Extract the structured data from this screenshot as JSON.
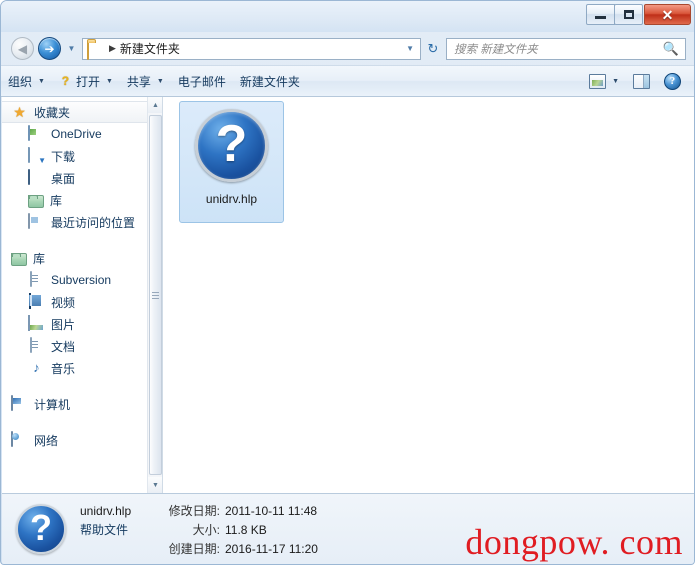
{
  "window": {
    "controls": {
      "minimize": "—",
      "maximize": "□",
      "close": "✕"
    }
  },
  "addressbar": {
    "back_icon": "◀",
    "forward_icon": "➔",
    "history_caret": "▼",
    "folder_icon": "folder-icon",
    "path_separator": "▶",
    "path": "新建文件夹",
    "path_caret": "▼",
    "refresh_icon": "↻"
  },
  "search": {
    "placeholder": "搜索 新建文件夹",
    "icon": "search-icon"
  },
  "toolbar": {
    "items": [
      {
        "label": "组织",
        "caret": "▼",
        "has_icon": false
      },
      {
        "label": "打开",
        "caret": "▼",
        "has_icon": true
      },
      {
        "label": "共享",
        "caret": "▼",
        "has_icon": false
      },
      {
        "label": "电子邮件",
        "caret": "",
        "has_icon": false
      },
      {
        "label": "新建文件夹",
        "caret": "",
        "has_icon": false
      }
    ],
    "view_caret": "▼",
    "view_icon": "view-options-icon",
    "pane_icon": "preview-pane-icon",
    "help_icon": "?"
  },
  "sidebar": {
    "favorites": {
      "label": "收藏夹",
      "icon": "star-icon",
      "items": [
        {
          "label": "OneDrive",
          "icon": "onedrive-icon"
        },
        {
          "label": "下载",
          "icon": "download-icon"
        },
        {
          "label": "桌面",
          "icon": "desktop-icon"
        },
        {
          "label": "库",
          "icon": "library-folder-icon"
        },
        {
          "label": "最近访问的位置",
          "icon": "recent-places-icon"
        }
      ]
    },
    "libraries": {
      "label": "库",
      "icon": "library-folder-icon",
      "items": [
        {
          "label": "Subversion",
          "icon": "document-icon"
        },
        {
          "label": "视频",
          "icon": "video-icon"
        },
        {
          "label": "图片",
          "icon": "picture-icon"
        },
        {
          "label": "文档",
          "icon": "document-icon"
        },
        {
          "label": "音乐",
          "icon": "music-icon"
        }
      ]
    },
    "computer": {
      "label": "计算机",
      "icon": "computer-icon"
    },
    "network": {
      "label": "网络",
      "icon": "network-icon"
    },
    "scrollbar": {
      "up": "▲",
      "down": "▼"
    }
  },
  "content": {
    "file": {
      "name": "unidrv.hlp",
      "icon": "help-file-icon",
      "icon_glyph": "?",
      "selected": true
    }
  },
  "details": {
    "icon": "help-file-icon",
    "icon_glyph": "?",
    "file_name": "unidrv.hlp",
    "file_type": "帮助文件",
    "modified_label": "修改日期:",
    "modified_value": "2011-10-11 11:48",
    "size_label": "大小:",
    "size_value": "11.8 KB",
    "created_label": "创建日期:",
    "created_value": "2016-11-17 11:20"
  },
  "watermark": {
    "text": "dongpow. com",
    "color": "#e01c22"
  }
}
